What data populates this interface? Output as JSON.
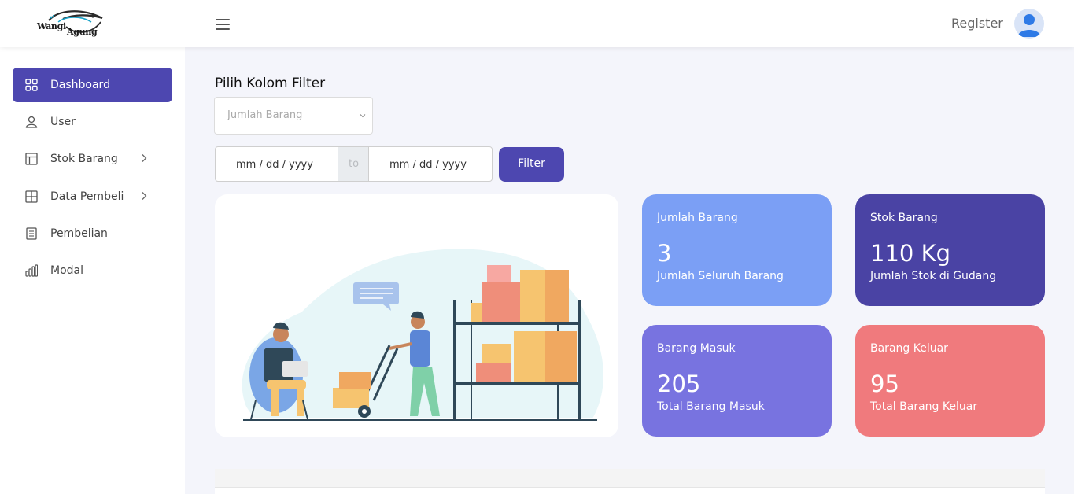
{
  "header": {
    "logo_line1": "Wangi",
    "logo_line2": "Agung",
    "register_label": "Register"
  },
  "sidebar": {
    "items": [
      {
        "label": "Dashboard",
        "active": true
      },
      {
        "label": "User"
      },
      {
        "label": "Stok Barang",
        "has_children": true
      },
      {
        "label": "Data Pembeli",
        "has_children": true
      },
      {
        "label": "Pembelian"
      },
      {
        "label": "Modal"
      }
    ]
  },
  "filter": {
    "title": "Pilih Kolom Filter",
    "select_value": "Jumlah Barang",
    "date_from_placeholder": "mm / dd / yyyy",
    "date_separator": "to",
    "date_to_placeholder": "mm / dd / yyyy",
    "button_label": "Filter"
  },
  "cards": [
    {
      "title": "Jumlah Barang",
      "value": "3",
      "subtitle": "Jumlah Seluruh Barang",
      "color": "#7b9ff5"
    },
    {
      "title": "Stok Barang",
      "value": "110 Kg",
      "subtitle": "Jumlah Stok di Gudang",
      "color": "#4a43a4"
    },
    {
      "title": "Barang Masuk",
      "value": "205",
      "subtitle": "Total Barang Masuk",
      "color": "#7873e0"
    },
    {
      "title": "Barang Keluar",
      "value": "95",
      "subtitle": "Total Barang Keluar",
      "color": "#f07a7d"
    }
  ],
  "colors": {
    "primary": "#4d47b0",
    "background": "#f4f5fb"
  }
}
